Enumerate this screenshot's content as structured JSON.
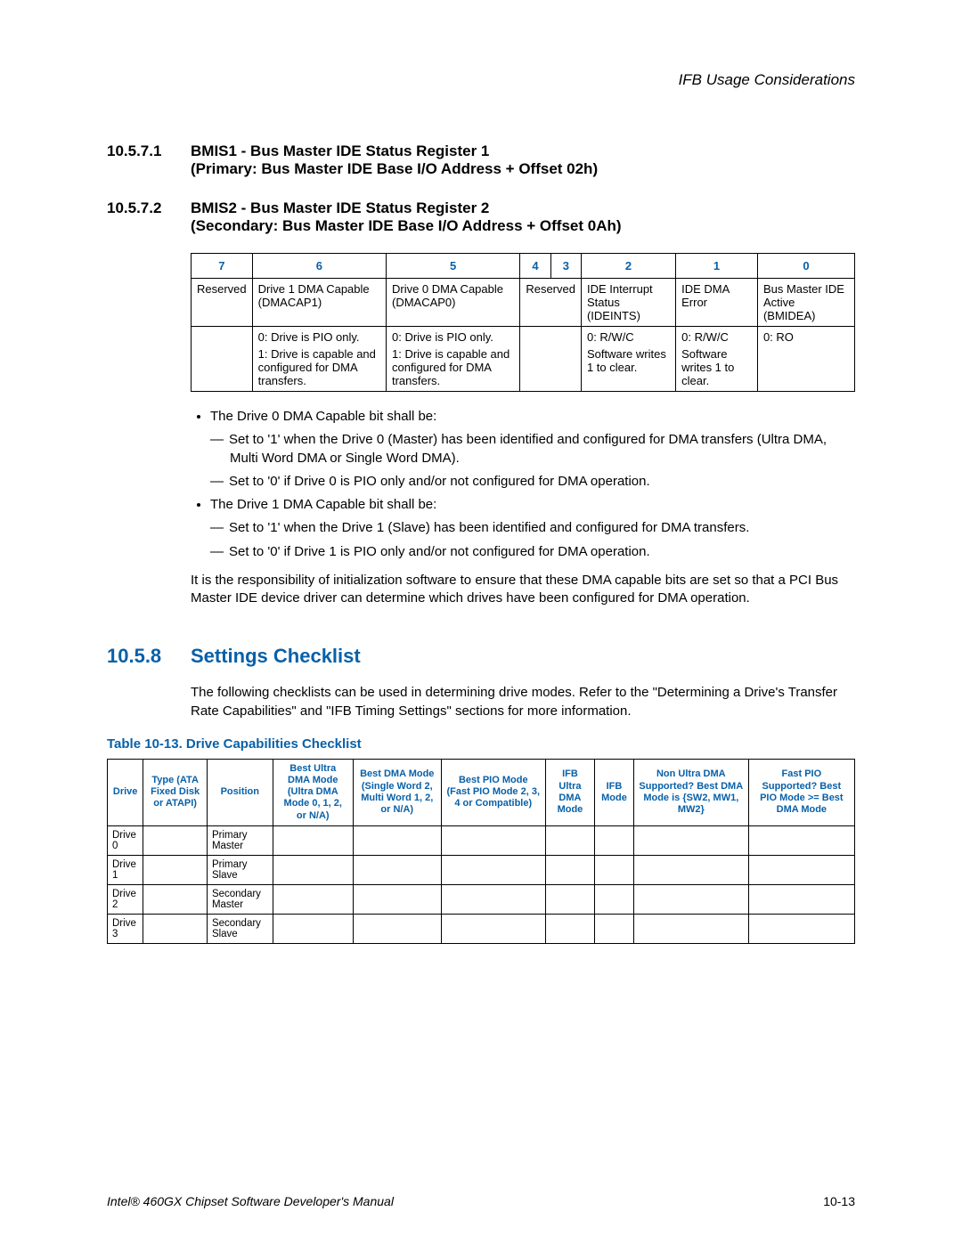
{
  "header": "IFB Usage Considerations",
  "sections": [
    {
      "num": "10.5.7.1",
      "title_l1": "BMIS1 - Bus Master IDE Status Register 1",
      "title_l2": "(Primary: Bus Master IDE Base I/O Address + Offset 02h)"
    },
    {
      "num": "10.5.7.2",
      "title_l1": "BMIS2 - Bus Master IDE Status Register 2",
      "title_l2": "(Secondary: Bus Master IDE Base I/O Address + Offset 0Ah)"
    }
  ],
  "bitfield": {
    "headers": [
      "7",
      "6",
      "5",
      "4",
      "3",
      "2",
      "1",
      "0"
    ],
    "row1": {
      "c7": "Reserved",
      "c6": "Drive 1 DMA Capable (DMACAP1)",
      "c5": "Drive 0 DMA Capable (DMACAP0)",
      "c43": "Reserved",
      "c2": "IDE Interrupt Status (IDEINTS)",
      "c1": "IDE DMA Error",
      "c0": "Bus Master IDE Active (BMIDEA)"
    },
    "row2": {
      "c7": "",
      "c6a": "0: Drive is PIO only.",
      "c6b": "1: Drive is capable and configured for DMA transfers.",
      "c5a": "0: Drive is PIO only.",
      "c5b": "1: Drive is capable and configured for DMA transfers.",
      "c43": "",
      "c2a": "0: R/W/C",
      "c2b": "Software writes 1 to clear.",
      "c1a": "0: R/W/C",
      "c1b": "Software writes 1 to clear.",
      "c0": "0: RO"
    }
  },
  "bullets": {
    "b1": "The Drive 0 DMA Capable bit shall be:",
    "b1d1": "Set to '1' when the Drive 0 (Master) has been identified and configured for DMA transfers (Ultra DMA, Multi Word DMA or Single Word DMA).",
    "b1d2": "Set to '0' if Drive 0 is PIO only and/or not configured for DMA operation.",
    "b2": "The Drive 1 DMA Capable bit shall be:",
    "b2d1": "Set to '1' when the Drive 1 (Slave) has been identified and configured for DMA transfers.",
    "b2d2": "Set to '0' if Drive 1 is PIO only and/or not configured for DMA operation."
  },
  "para1": "It is the responsibility of initialization software to ensure that these DMA capable bits are set so that a PCI Bus Master IDE device driver can determine which drives have been configured for DMA operation.",
  "section_checklist": {
    "num": "10.5.8",
    "title": "Settings Checklist"
  },
  "para2": "The following checklists can be used in determining drive modes. Refer to the \"Determining a Drive's Transfer Rate Capabilities\" and \"IFB Timing Settings\" sections for more information.",
  "table_caption": "Table 10-13. Drive Capabilities Checklist",
  "checklist": {
    "headers": [
      "Drive",
      "Type (ATA Fixed Disk or ATAPI)",
      "Position",
      "Best Ultra DMA Mode (Ultra DMA Mode 0, 1, 2, or N/A)",
      "Best DMA Mode (Single Word 2, Multi Word 1, 2, or N/A)",
      "Best PIO Mode (Fast PIO Mode 2, 3, 4 or Compatible)",
      "IFB Ultra DMA Mode",
      "IFB Mode",
      "Non Ultra DMA Supported? Best DMA Mode is {SW2, MW1, MW2}",
      "Fast PIO Supported? Best PIO Mode >= Best DMA Mode"
    ],
    "rows": [
      {
        "drive": "Drive 0",
        "position": "Primary Master"
      },
      {
        "drive": "Drive 1",
        "position": "Primary Slave"
      },
      {
        "drive": "Drive 2",
        "position": "Secondary Master"
      },
      {
        "drive": "Drive 3",
        "position": "Secondary Slave"
      }
    ]
  },
  "footer": {
    "left": "Intel® 460GX Chipset Software Developer's Manual",
    "right": "10-13"
  }
}
